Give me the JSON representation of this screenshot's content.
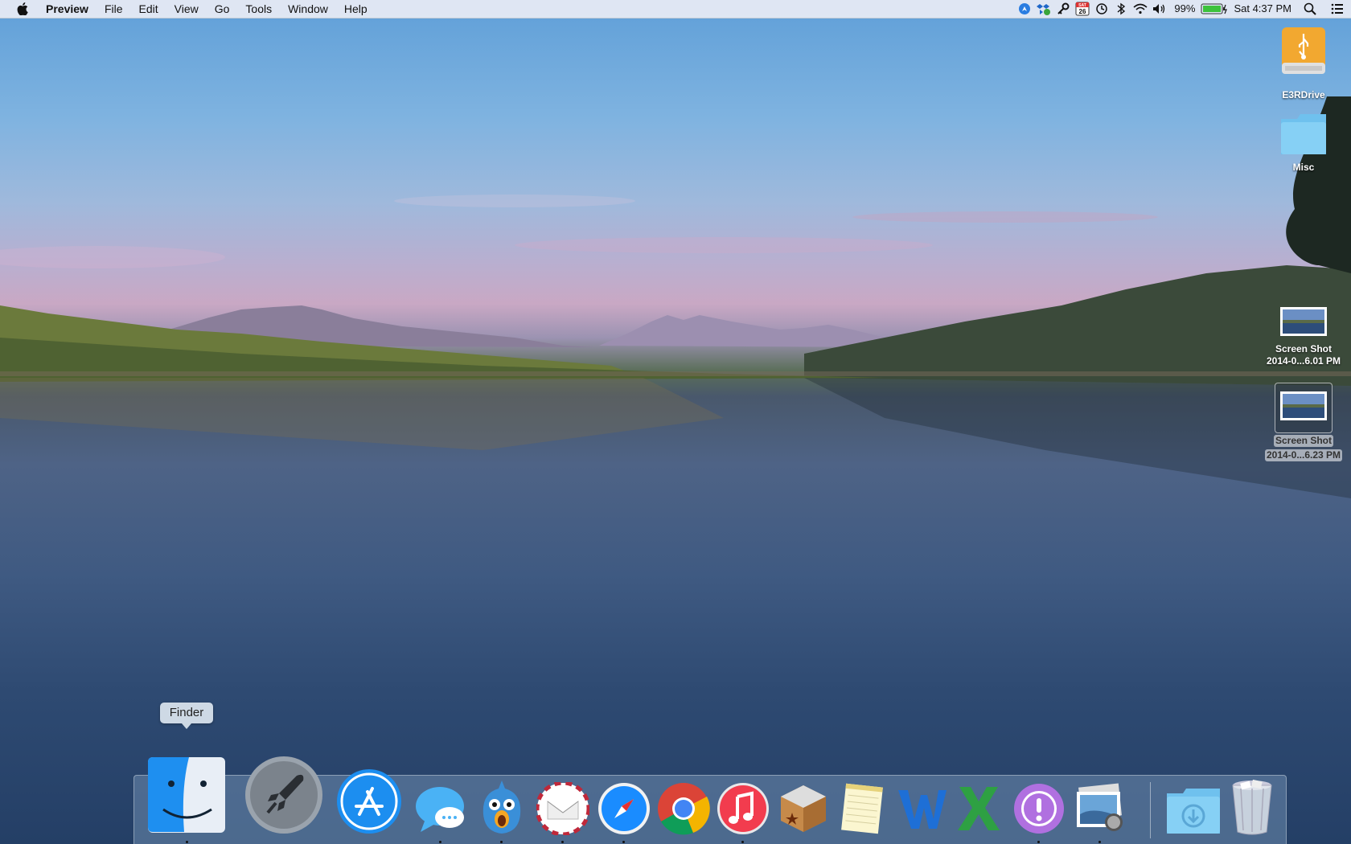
{
  "menubar": {
    "app_name": "Preview",
    "items": [
      "File",
      "Edit",
      "View",
      "Go",
      "Tools",
      "Window",
      "Help"
    ],
    "status": {
      "battery_percent": "99%",
      "clock": "Sat 4:37 PM",
      "calendar_badge_top": "SAT",
      "calendar_badge_day": "26"
    }
  },
  "desktop_icons": [
    {
      "label": "E3RDrive",
      "kind": "usb-drive"
    },
    {
      "label": "Misc",
      "kind": "folder"
    },
    {
      "label_line1": "Screen Shot",
      "label_line2": "2014-0...6.01 PM",
      "kind": "screenshot"
    },
    {
      "label_line1": "Screen Shot",
      "label_line2": "2014-0...6.23 PM",
      "kind": "screenshot",
      "selected": true
    }
  ],
  "dock": {
    "tooltip": "Finder",
    "apps": [
      "Finder",
      "Launchpad",
      "App Store",
      "Messages",
      "Tweetbot",
      "Airmail",
      "Safari",
      "Google Chrome",
      "iTunes",
      "Delivery Status",
      "Notes",
      "Microsoft Word",
      "Microsoft Excel",
      "Feedback Assistant",
      "Preview"
    ],
    "stack": "Downloads",
    "trash": "Trash"
  },
  "colors": {
    "menubar_bg": "#e8ecf4",
    "dock_bg": "#6e8caf",
    "accent_blue": "#1a8cff"
  }
}
